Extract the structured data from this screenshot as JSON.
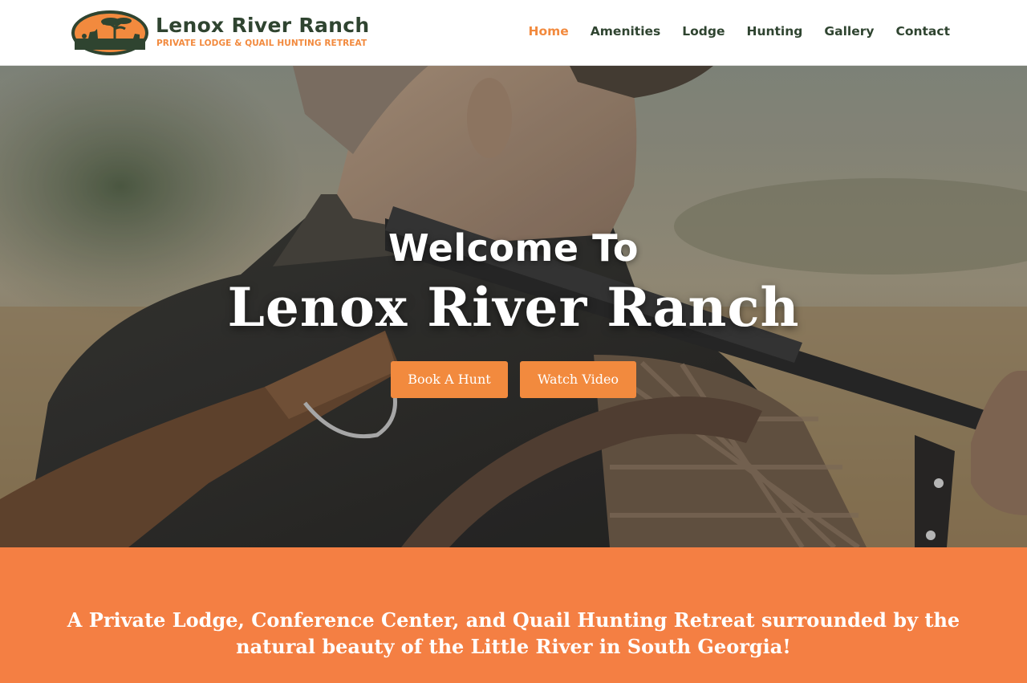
{
  "header": {
    "logo": {
      "title": "Lenox River Ranch",
      "tagline": "PRIVATE LODGE & QUAIL HUNTING RETREAT",
      "icon": "ranch-logo-icon"
    },
    "nav": [
      {
        "label": "Home",
        "active": true
      },
      {
        "label": "Amenities",
        "active": false
      },
      {
        "label": "Lodge",
        "active": false
      },
      {
        "label": "Hunting",
        "active": false
      },
      {
        "label": "Gallery",
        "active": false
      },
      {
        "label": "Contact",
        "active": false
      }
    ]
  },
  "hero": {
    "welcome": "Welcome To",
    "title": "Lenox River Ranch",
    "buttons": {
      "book": "Book A Hunt",
      "video": "Watch Video"
    }
  },
  "band": {
    "text": "A Private Lodge, Conference Center, and Quail Hunting Retreat surrounded by the natural beauty of the Little River in South Georgia!"
  },
  "colors": {
    "accent": "#f28a3e",
    "brand_green": "#2f4430",
    "band": "#f47f43"
  }
}
